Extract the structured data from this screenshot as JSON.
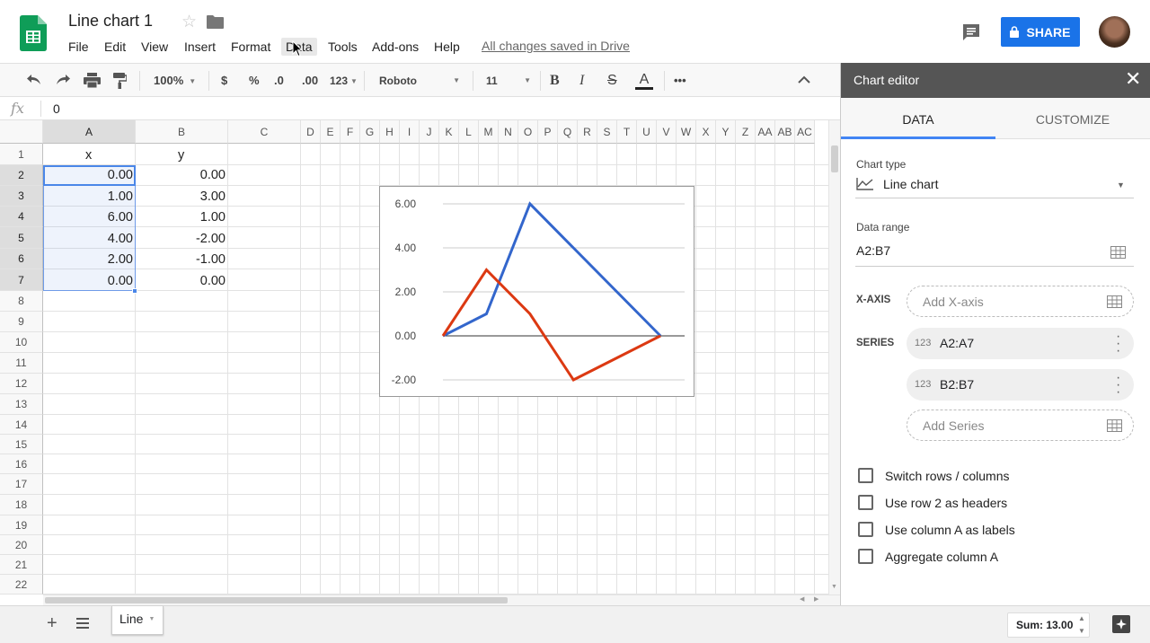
{
  "doc": {
    "title": "Line chart 1",
    "saved_status": "All changes saved in Drive"
  },
  "menu": [
    "File",
    "Edit",
    "View",
    "Insert",
    "Format",
    "Data",
    "Tools",
    "Add-ons",
    "Help"
  ],
  "share_label": "SHARE",
  "toolbar": {
    "zoom": "100%",
    "currency": "$",
    "percent": "%",
    "dec_decrease": ".0",
    "dec_increase": ".00",
    "more_formats": "123",
    "font": "Roboto",
    "font_size": "11"
  },
  "formula": {
    "fx": "fx",
    "value": "0"
  },
  "columns": [
    "A",
    "B",
    "C",
    "D",
    "E",
    "F",
    "G",
    "H",
    "I",
    "J",
    "K",
    "L",
    "M",
    "N",
    "O",
    "P",
    "Q",
    "R",
    "S",
    "T",
    "U",
    "V",
    "W",
    "X",
    "Y",
    "Z",
    "AA",
    "AB",
    "AC"
  ],
  "rows": [
    "1",
    "2",
    "3",
    "4",
    "5",
    "6",
    "7",
    "8",
    "9",
    "10",
    "11",
    "12",
    "13",
    "14",
    "15",
    "16",
    "17",
    "18",
    "19",
    "20",
    "21",
    "22"
  ],
  "cells": {
    "headers": [
      "x",
      "y"
    ],
    "x": [
      "0.00",
      "1.00",
      "6.00",
      "4.00",
      "2.00",
      "0.00"
    ],
    "y": [
      "0.00",
      "3.00",
      "1.00",
      "-2.00",
      "-1.00",
      "0.00"
    ]
  },
  "chart_data": {
    "type": "line",
    "x": [
      0,
      1,
      2,
      3,
      4,
      5
    ],
    "series": [
      {
        "values": [
          0,
          1,
          6,
          4,
          2,
          0
        ],
        "color": "#3366cc"
      },
      {
        "values": [
          0,
          3,
          1,
          -2,
          -1,
          0
        ],
        "color": "#dc3912"
      }
    ],
    "ylim": [
      -2,
      6
    ],
    "yticks": [
      "6.00",
      "4.00",
      "2.00",
      "0.00",
      "-2.00"
    ],
    "grid": true
  },
  "sheet_tab": "Line",
  "sum_label": "Sum: 13.00",
  "editor": {
    "title": "Chart editor",
    "tabs": [
      "DATA",
      "CUSTOMIZE"
    ],
    "chart_type_label": "Chart type",
    "chart_type_value": "Line chart",
    "data_range_label": "Data range",
    "data_range_value": "A2:B7",
    "xaxis_label": "X-AXIS",
    "xaxis_placeholder": "Add X-axis",
    "series_label": "SERIES",
    "series": [
      "A2:A7",
      "B2:B7"
    ],
    "series_icon": "123",
    "add_series": "Add Series",
    "checkboxes": [
      "Switch rows / columns",
      "Use row 2 as headers",
      "Use column A as labels",
      "Aggregate column A"
    ]
  }
}
